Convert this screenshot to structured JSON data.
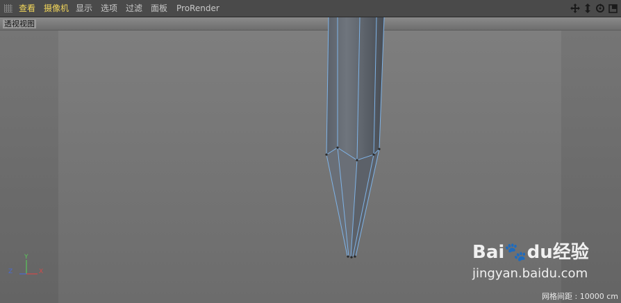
{
  "menubar": {
    "items": [
      {
        "label": "查看",
        "active": true
      },
      {
        "label": "摄像机",
        "active": true
      },
      {
        "label": "显示",
        "active": false
      },
      {
        "label": "选项",
        "active": false
      },
      {
        "label": "过滤",
        "active": false
      },
      {
        "label": "面板",
        "active": false
      },
      {
        "label": "ProRender",
        "active": false
      }
    ],
    "tools": [
      "move-view-icon",
      "zoom-view-icon",
      "rotate-view-icon",
      "maximize-view-icon"
    ]
  },
  "viewport": {
    "name": "透视视图",
    "grid_spacing_label": "网格间距 : 10000 cm",
    "axes": {
      "x": "X",
      "y": "Y",
      "z": "Z"
    }
  },
  "watermark": {
    "brand": "Bai",
    "brand_mid": "du",
    "brand_cn": "经验",
    "url": "jingyan.baidu.com"
  }
}
